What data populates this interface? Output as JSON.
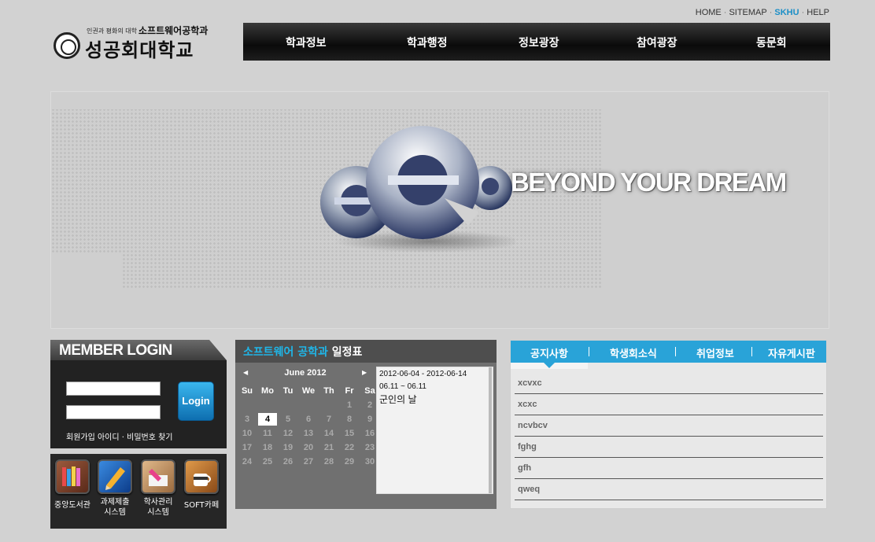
{
  "util_links": [
    "HOME",
    "SITEMAP",
    "SKHU",
    "HELP"
  ],
  "logo": {
    "motto": "인권과 평화의 대학 -",
    "dept": "소프트웨어공학과",
    "university": "성공회대학교"
  },
  "nav": [
    "학과정보",
    "학과행정",
    "정보광장",
    "참여광장",
    "동문회"
  ],
  "banner": {
    "slogan": "BEYOND YOUR DREAM"
  },
  "login": {
    "heading": "MEMBER LOGIN",
    "button": "Login",
    "links": "회원가입  아이디 · 비밀번호 찾기"
  },
  "quick_links": [
    {
      "label": "중앙도서관",
      "icon": "books-icon",
      "color": "#7a3d2a"
    },
    {
      "label": "과제제출\n시스템",
      "icon": "pencil-icon",
      "color": "#1d64b8"
    },
    {
      "label": "학사관리\n시스템",
      "icon": "marker-icon",
      "color": "#c99868"
    },
    {
      "label": "SOFT카페",
      "icon": "coffee-cup-icon",
      "color": "#c07a2e"
    }
  ],
  "calendar": {
    "title_highlight": "소프트웨어 공학과",
    "title_rest": "일정표",
    "month": "June 2012",
    "prev": "◀",
    "next": "▶",
    "weekdays": [
      "Su",
      "Mo",
      "Tu",
      "We",
      "Th",
      "Fr",
      "Sa"
    ],
    "weeks": [
      [
        "",
        "",
        "",
        "",
        "",
        "1",
        "2"
      ],
      [
        "3",
        "4",
        "5",
        "6",
        "7",
        "8",
        "9"
      ],
      [
        "10",
        "11",
        "12",
        "13",
        "14",
        "15",
        "16"
      ],
      [
        "17",
        "18",
        "19",
        "20",
        "21",
        "22",
        "23"
      ],
      [
        "24",
        "25",
        "26",
        "27",
        "28",
        "29",
        "30"
      ]
    ],
    "today": "4",
    "events": {
      "range": "2012-06-04 - 2012-06-14",
      "dates": "06.11 ~ 06.11",
      "name": "군인의 날"
    }
  },
  "board": {
    "tabs": [
      "공지사항",
      "학생회소식",
      "취업정보",
      "자유게시판"
    ],
    "items": [
      "xcvxc",
      "xcxc",
      "ncvbcv",
      "fghg",
      "gfh",
      "qweq"
    ]
  }
}
